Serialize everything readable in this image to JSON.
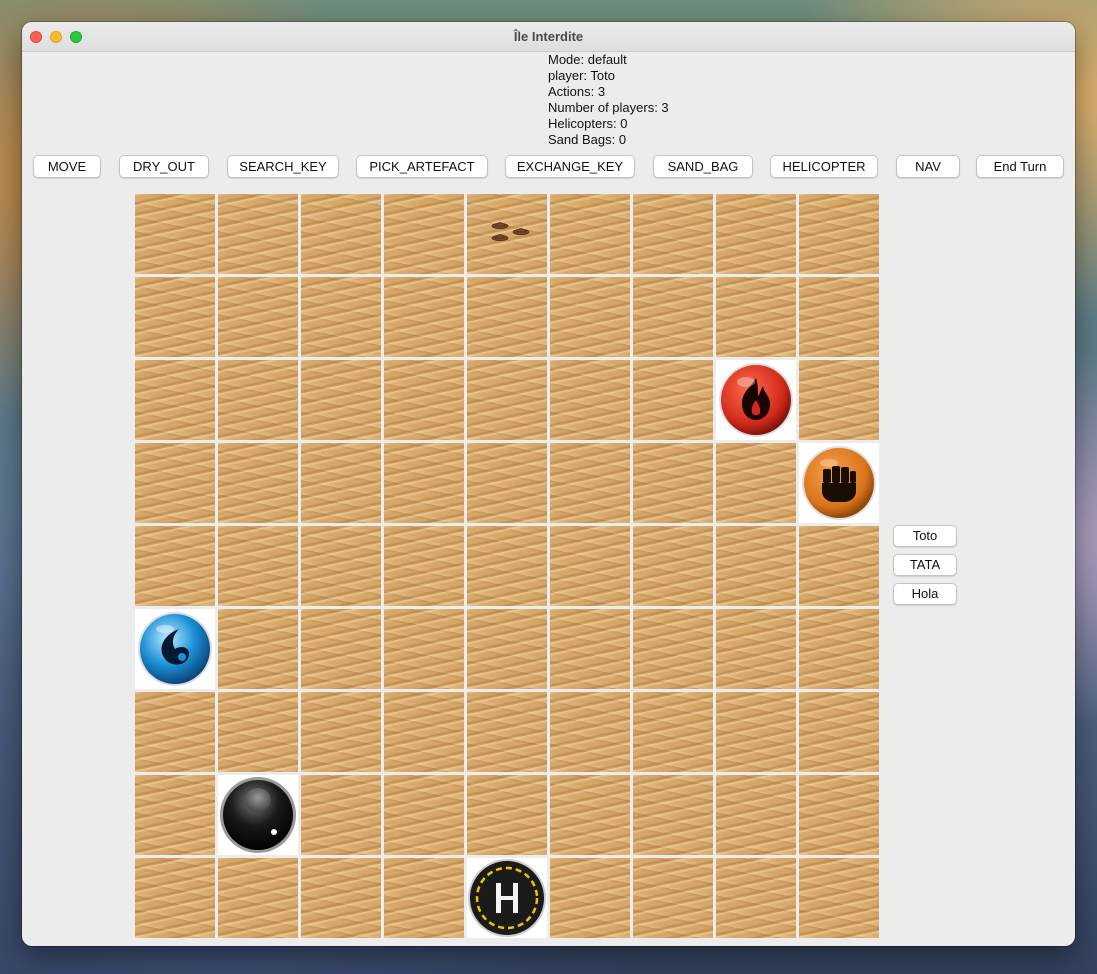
{
  "window": {
    "title": "Île Interdite"
  },
  "status": {
    "mode": "Mode: default",
    "player": "player: Toto",
    "actions": "Actions: 3",
    "players_count": "Number of players: 3",
    "helicopters": "Helicopters: 0",
    "sand_bags": "Sand Bags: 0"
  },
  "toolbar": {
    "move": "MOVE",
    "dry_out": "DRY_OUT",
    "search_key": "SEARCH_KEY",
    "pick_artefact": "PICK_ARTEFACT",
    "exchange_key": "EXCHANGE_KEY",
    "sand_bag": "SAND_BAG",
    "helicopter": "HELICOPTER",
    "nav": "NAV",
    "end_turn": "End Turn"
  },
  "players": [
    "Toto",
    "TATA",
    "Hola"
  ],
  "board": {
    "rows": 9,
    "cols": 9,
    "special_tiles": [
      {
        "row": 0,
        "col": 4,
        "icon": "players-pawns-icon"
      },
      {
        "row": 2,
        "col": 7,
        "icon": "fire-artefact-icon"
      },
      {
        "row": 3,
        "col": 8,
        "icon": "earth-artefact-icon"
      },
      {
        "row": 5,
        "col": 0,
        "icon": "water-artefact-icon"
      },
      {
        "row": 7,
        "col": 1,
        "icon": "air-artefact-icon"
      },
      {
        "row": 8,
        "col": 4,
        "icon": "heliport-icon"
      }
    ],
    "colors": {
      "sand": "#d6a769",
      "fire": "#d12a1a",
      "earth": "#d9741c",
      "water": "#1c8fd6",
      "air": "#1a1a1a",
      "heliport": "#1b1b1b"
    }
  }
}
